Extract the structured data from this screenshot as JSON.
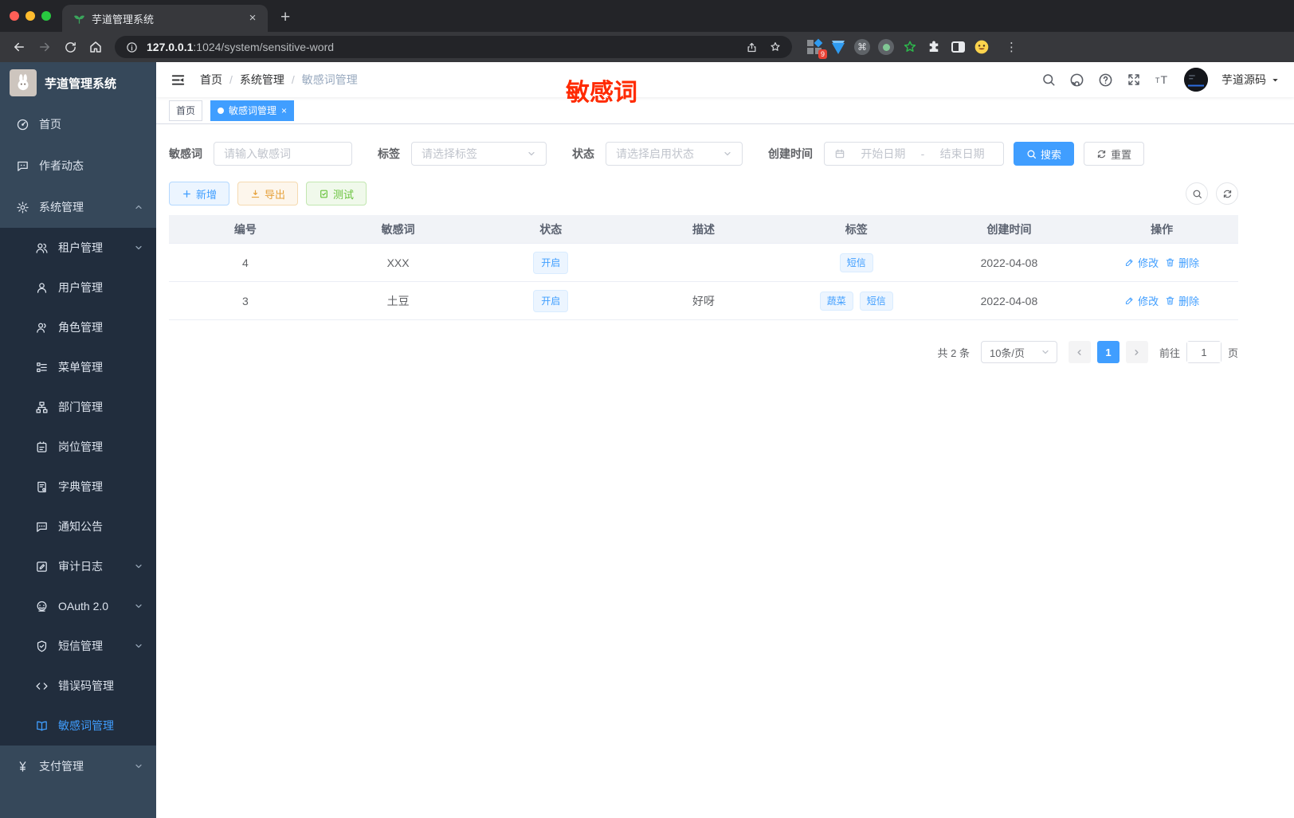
{
  "colors": {
    "accent": "#409eff",
    "annotation_red": "#ff2a00",
    "sidebar_bg": "#36485a",
    "submenu_bg": "#212d3d"
  },
  "browser": {
    "tab_title": "芋道管理系统",
    "url_host": "127.0.0.1",
    "url_rest": ":1024/system/sensitive-word",
    "extension_badge": "9"
  },
  "sidebar": {
    "title": "芋道管理系统",
    "items": [
      {
        "label": "首页",
        "icon": "dashboard-icon",
        "level": "top"
      },
      {
        "label": "作者动态",
        "icon": "author-news-icon",
        "level": "top"
      },
      {
        "label": "系统管理",
        "icon": "gear-icon",
        "level": "top",
        "chevron": "up"
      },
      {
        "label": "租户管理",
        "icon": "tenant-icon",
        "level": "sub",
        "chevron": "down"
      },
      {
        "label": "用户管理",
        "icon": "user-icon",
        "level": "sub"
      },
      {
        "label": "角色管理",
        "icon": "role-icon",
        "level": "sub"
      },
      {
        "label": "菜单管理",
        "icon": "menu-tree-icon",
        "level": "sub"
      },
      {
        "label": "部门管理",
        "icon": "department-icon",
        "level": "sub"
      },
      {
        "label": "岗位管理",
        "icon": "post-icon",
        "level": "sub"
      },
      {
        "label": "字典管理",
        "icon": "dictionary-icon",
        "level": "sub"
      },
      {
        "label": "通知公告",
        "icon": "notice-icon",
        "level": "sub"
      },
      {
        "label": "审计日志",
        "icon": "audit-log-icon",
        "level": "sub",
        "chevron": "down"
      },
      {
        "label": "OAuth 2.0",
        "icon": "oauth-icon",
        "level": "sub",
        "chevron": "down"
      },
      {
        "label": "短信管理",
        "icon": "sms-icon",
        "level": "sub",
        "chevron": "down"
      },
      {
        "label": "错误码管理",
        "icon": "error-code-icon",
        "level": "sub"
      },
      {
        "label": "敏感词管理",
        "icon": "sensitive-word-icon",
        "level": "sub",
        "active": true
      },
      {
        "label": "支付管理",
        "icon": "payment-icon",
        "level": "top",
        "chevron": "down"
      }
    ]
  },
  "header": {
    "breadcrumb": [
      "首页",
      "系统管理",
      "敏感词管理"
    ],
    "annotation": "敏感词",
    "username": "芋道源码"
  },
  "tabs": [
    {
      "label": "首页",
      "active": false
    },
    {
      "label": "敏感词管理",
      "active": true
    }
  ],
  "filters": {
    "keyword_label": "敏感词",
    "keyword_placeholder": "请输入敏感词",
    "tag_label": "标签",
    "tag_placeholder": "请选择标签",
    "status_label": "状态",
    "status_placeholder": "请选择启用状态",
    "date_label": "创建时间",
    "date_start_placeholder": "开始日期",
    "date_separator": "-",
    "date_end_placeholder": "结束日期",
    "search_label": "搜索",
    "reset_label": "重置"
  },
  "toolbar": {
    "add_label": "新增",
    "export_label": "导出",
    "test_label": "测试"
  },
  "table": {
    "headers": [
      "编号",
      "敏感词",
      "状态",
      "描述",
      "标签",
      "创建时间",
      "操作"
    ],
    "edit_label": "修改",
    "delete_label": "删除",
    "rows": [
      {
        "id": "4",
        "word": "XXX",
        "status": "开启",
        "description": "",
        "tags": [
          "短信"
        ],
        "created": "2022-04-08"
      },
      {
        "id": "3",
        "word": "土豆",
        "status": "开启",
        "description": "好呀",
        "tags": [
          "蔬菜",
          "短信"
        ],
        "created": "2022-04-08"
      }
    ]
  },
  "pagination": {
    "total": "共 2 条",
    "page_size": "10条/页",
    "current_page": "1",
    "goto_label": "前往",
    "goto_value": "1",
    "page_label": "页"
  }
}
